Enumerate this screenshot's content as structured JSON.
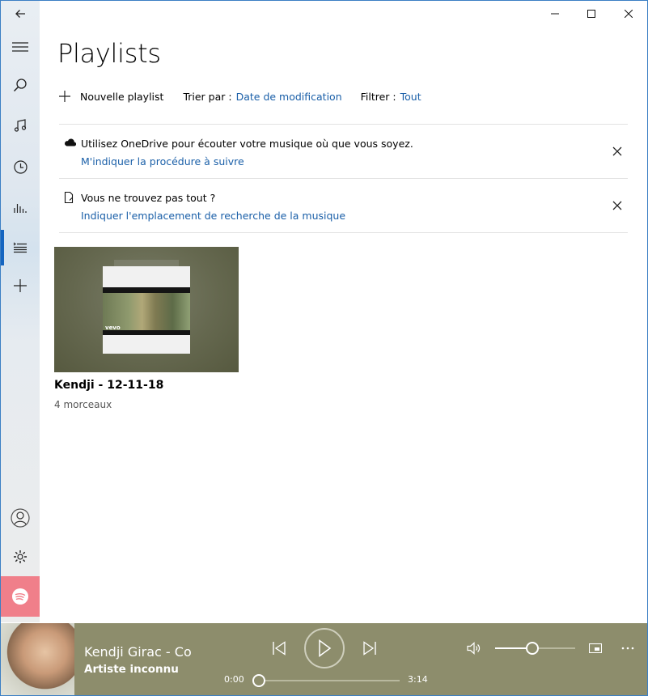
{
  "page": {
    "title": "Playlists"
  },
  "toolbar": {
    "new_playlist": "Nouvelle playlist",
    "sort_label": "Trier par :",
    "sort_value": "Date de modification",
    "filter_label": "Filtrer :",
    "filter_value": "Tout"
  },
  "notices": [
    {
      "icon": "cloud-icon",
      "text": "Utilisez OneDrive pour écouter votre musique où que vous soyez.",
      "link": "M'indiquer la procédure à suivre"
    },
    {
      "icon": "document-icon",
      "text": "Vous ne trouvez pas tout ?",
      "link": "Indiquer l'emplacement de recherche de la musique"
    }
  ],
  "playlists": [
    {
      "title": "Kendji - 12-11-18",
      "count": "4 morceaux",
      "badge": "vevo"
    }
  ],
  "sidebar": {
    "items": [
      "back-arrow-icon",
      "hamburger-menu-icon",
      "search-icon",
      "music-note-icon",
      "clock-icon",
      "equalizer-icon",
      "playlist-icon",
      "plus-icon",
      "account-icon",
      "settings-gear-icon",
      "spotify-icon"
    ],
    "active": "playlist-icon"
  },
  "player": {
    "song": "Kendji Girac - Col",
    "artist": "Artiste inconnu",
    "elapsed": "0:00",
    "duration": "3:14",
    "progress": 0,
    "volume": 0.45
  },
  "colors": {
    "accent": "#1a5fa8",
    "sidebar_active": "#1565c0",
    "player_bg": "#8d8d6c",
    "spotify_bg": "#f07f8a"
  }
}
